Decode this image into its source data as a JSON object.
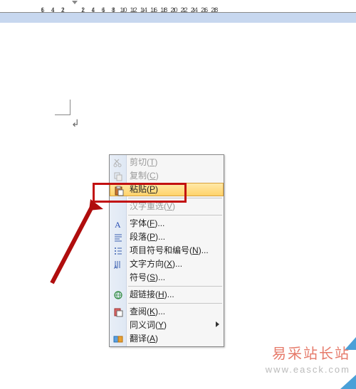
{
  "ruler": {
    "ticks": [
      -6,
      -4,
      -2,
      2,
      4,
      6,
      8,
      10,
      12,
      14,
      16,
      18,
      20,
      22,
      24,
      26,
      28
    ]
  },
  "menu": {
    "cut": {
      "label": "剪切",
      "accel": "T"
    },
    "copy": {
      "label": "复制",
      "accel": "C"
    },
    "paste": {
      "label": "粘贴",
      "accel": "P"
    },
    "reconvert": {
      "label": "汉字重选",
      "accel": "V"
    },
    "font": {
      "label": "字体",
      "accel": "F",
      "suffix": "..."
    },
    "paragraph": {
      "label": "段落",
      "accel": "P",
      "suffix": "..."
    },
    "bullets": {
      "label": "项目符号和编号",
      "accel": "N",
      "suffix": "..."
    },
    "direction": {
      "label": "文字方向",
      "accel": "X",
      "suffix": "..."
    },
    "symbol": {
      "label": "符号",
      "accel": "S",
      "suffix": "..."
    },
    "hyperlink": {
      "label": "超链接",
      "accel": "H",
      "suffix": "..."
    },
    "lookup": {
      "label": "查阅",
      "accel": "K",
      "suffix": "..."
    },
    "synonym": {
      "label": "同义词",
      "accel": "Y"
    },
    "translate": {
      "label": "翻译",
      "accel": "A"
    }
  },
  "watermark": {
    "line1": "易采站长站",
    "line2": "www.easck.com"
  },
  "colors": {
    "highlight_border": "#c21010",
    "arrow": "#b00d0d",
    "menu_hover_a": "#ffe9a8",
    "menu_hover_b": "#ffd36b"
  }
}
